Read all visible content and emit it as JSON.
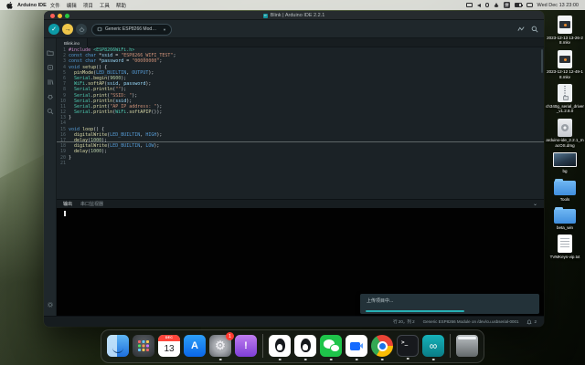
{
  "menu_bar": {
    "app_name": "Arduino IDE",
    "menus": [
      "文件",
      "编辑",
      "项目",
      "工具",
      "帮助"
    ],
    "input_method": "拼",
    "clock": "Wed Dec 13 23:00",
    "status_icon_names": [
      "screen-mirroring-icon",
      "volume-icon",
      "bluetooth-icon",
      "control-center-icon",
      "wifi-icon",
      "input-method-icon",
      "battery-icon",
      "siri-icon"
    ]
  },
  "window": {
    "title": "Blink | Arduino IDE 2.2.1",
    "toolbar": {
      "verify_glyph": "✓",
      "upload_glyph": "→",
      "board_selector": "Generic ESP8266 Mod…",
      "dropdown_caret": "▼",
      "right_icon_names": [
        "serial-plotter-icon",
        "serial-monitor-icon"
      ]
    },
    "activity_bar_icon_names": [
      "sketchbook-folder-icon",
      "boards-manager-icon",
      "library-manager-icon",
      "debug-icon",
      "search-icon",
      "settings-gear-icon"
    ],
    "tab": "Blink.ino",
    "panel": {
      "tabs": [
        "输出",
        "串口监视器"
      ],
      "active_tab": "输出",
      "collapse_glyph": "⌄",
      "console_text": ""
    },
    "toast": {
      "text": "上传项目中...",
      "progress_pct": 55
    },
    "status_bar": {
      "cursor_position": "行 20，列 2",
      "board_info": "Generic ESP8266 Module on /dev/cu.usbserial-0001",
      "notification_count": "2"
    }
  },
  "editor": {
    "syntax_colors": {
      "d": "#c586c0",
      "t": "#4ec9b0",
      "k": "#569cd6",
      "f": "#dcdcaa",
      "s": "#ce9178",
      "n": "#b5cea8",
      "v": "#9cdcfe",
      "p": "#cfd4d8"
    },
    "lines": [
      {
        "n": 1,
        "seg": [
          [
            "d",
            "#include"
          ],
          [
            "p",
            " "
          ],
          [
            "t",
            "<ESP8266WiFi.h>"
          ]
        ]
      },
      {
        "n": 2,
        "seg": [
          [
            "k",
            "const"
          ],
          [
            "p",
            " "
          ],
          [
            "k",
            "char"
          ],
          [
            "p",
            " *"
          ],
          [
            "v",
            "ssid"
          ],
          [
            "p",
            " = "
          ],
          [
            "s",
            "\"ESP8266_WIFI_TEST\""
          ],
          [
            "p",
            ";"
          ]
        ]
      },
      {
        "n": 3,
        "seg": [
          [
            "k",
            "const"
          ],
          [
            "p",
            " "
          ],
          [
            "k",
            "char"
          ],
          [
            "p",
            " *"
          ],
          [
            "v",
            "password"
          ],
          [
            "p",
            " = "
          ],
          [
            "s",
            "\"00000000\""
          ],
          [
            "p",
            ";"
          ]
        ]
      },
      {
        "n": 4,
        "seg": [
          [
            "k",
            "void"
          ],
          [
            "p",
            " "
          ],
          [
            "f",
            "setup"
          ],
          [
            "p",
            "() {"
          ]
        ]
      },
      {
        "n": 5,
        "seg": [
          [
            "p",
            "  "
          ],
          [
            "f",
            "pinMode"
          ],
          [
            "p",
            "("
          ],
          [
            "k",
            "LED_BUILTIN"
          ],
          [
            "p",
            ", "
          ],
          [
            "k",
            "OUTPUT"
          ],
          [
            "p",
            ");"
          ]
        ]
      },
      {
        "n": 6,
        "seg": [
          [
            "p",
            "  "
          ],
          [
            "t",
            "Serial"
          ],
          [
            "p",
            "."
          ],
          [
            "f",
            "begin"
          ],
          [
            "p",
            "("
          ],
          [
            "n",
            "9600"
          ],
          [
            "p",
            ");"
          ]
        ]
      },
      {
        "n": 7,
        "seg": [
          [
            "p",
            "  "
          ],
          [
            "t",
            "WiFi"
          ],
          [
            "p",
            "."
          ],
          [
            "f",
            "softAP"
          ],
          [
            "p",
            "("
          ],
          [
            "v",
            "ssid"
          ],
          [
            "p",
            ", "
          ],
          [
            "v",
            "password"
          ],
          [
            "p",
            ");"
          ]
        ]
      },
      {
        "n": 8,
        "seg": [
          [
            "p",
            "  "
          ],
          [
            "t",
            "Serial"
          ],
          [
            "p",
            "."
          ],
          [
            "f",
            "println"
          ],
          [
            "p",
            "("
          ],
          [
            "s",
            "\"\""
          ],
          [
            "p",
            ");"
          ]
        ]
      },
      {
        "n": 9,
        "seg": [
          [
            "p",
            "  "
          ],
          [
            "t",
            "Serial"
          ],
          [
            "p",
            "."
          ],
          [
            "f",
            "print"
          ],
          [
            "p",
            "("
          ],
          [
            "s",
            "\"SSID: \""
          ],
          [
            "p",
            ");"
          ]
        ]
      },
      {
        "n": 10,
        "seg": [
          [
            "p",
            "  "
          ],
          [
            "t",
            "Serial"
          ],
          [
            "p",
            "."
          ],
          [
            "f",
            "println"
          ],
          [
            "p",
            "("
          ],
          [
            "v",
            "ssid"
          ],
          [
            "p",
            ");"
          ]
        ]
      },
      {
        "n": 11,
        "seg": [
          [
            "p",
            "  "
          ],
          [
            "t",
            "Serial"
          ],
          [
            "p",
            "."
          ],
          [
            "f",
            "print"
          ],
          [
            "p",
            "("
          ],
          [
            "s",
            "\"AP IP address: \""
          ],
          [
            "p",
            ");"
          ]
        ]
      },
      {
        "n": 12,
        "seg": [
          [
            "p",
            "  "
          ],
          [
            "t",
            "Serial"
          ],
          [
            "p",
            "."
          ],
          [
            "f",
            "println"
          ],
          [
            "p",
            "("
          ],
          [
            "t",
            "WiFi"
          ],
          [
            "p",
            "."
          ],
          [
            "f",
            "softAPIP"
          ],
          [
            "p",
            "());"
          ]
        ]
      },
      {
        "n": 13,
        "seg": [
          [
            "p",
            "}"
          ]
        ]
      },
      {
        "n": 14,
        "seg": []
      },
      {
        "n": 15,
        "seg": [
          [
            "k",
            "void"
          ],
          [
            "p",
            " "
          ],
          [
            "f",
            "loop"
          ],
          [
            "p",
            "() {"
          ]
        ]
      },
      {
        "n": 16,
        "seg": [
          [
            "p",
            "  "
          ],
          [
            "f",
            "digitalWrite"
          ],
          [
            "p",
            "("
          ],
          [
            "k",
            "LED_BUILTIN"
          ],
          [
            "p",
            ", "
          ],
          [
            "k",
            "HIGH"
          ],
          [
            "p",
            ");"
          ]
        ]
      },
      {
        "n": 17,
        "seg": [
          [
            "p",
            "  "
          ],
          [
            "f",
            "delay"
          ],
          [
            "p",
            "("
          ],
          [
            "n",
            "1000"
          ],
          [
            "p",
            ");"
          ]
        ]
      },
      {
        "n": 18,
        "seg": [
          [
            "p",
            "  "
          ],
          [
            "f",
            "digitalWrite"
          ],
          [
            "p",
            "("
          ],
          [
            "k",
            "LED_BUILTIN"
          ],
          [
            "p",
            ", "
          ],
          [
            "k",
            "LOW"
          ],
          [
            "p",
            ");"
          ]
        ]
      },
      {
        "n": 19,
        "seg": [
          [
            "p",
            "  "
          ],
          [
            "f",
            "delay"
          ],
          [
            "p",
            "("
          ],
          [
            "n",
            "1000"
          ],
          [
            "p",
            ");"
          ]
        ]
      },
      {
        "n": 20,
        "seg": [
          [
            "p",
            "}"
          ]
        ]
      },
      {
        "n": 21,
        "seg": []
      }
    ]
  },
  "desktop_icons": [
    {
      "kind": "video",
      "label": "2023-12-13 13-26-28.mkv"
    },
    {
      "kind": "video",
      "label": "2023-12-12 12-49-18.mkv"
    },
    {
      "kind": "archive",
      "label": "ch340g_serial_driver_v1.2.8.0"
    },
    {
      "kind": "dmg",
      "label": "arduino-ide_2.2.1_macOS.dmg"
    },
    {
      "kind": "image",
      "label": "bg"
    },
    {
      "kind": "folder",
      "label": "Tools"
    },
    {
      "kind": "folder",
      "label": "beta_win"
    },
    {
      "kind": "text",
      "label": "TVMKeys-vip.txt"
    }
  ],
  "dock": {
    "items": [
      {
        "name": "finder",
        "running": true
      },
      {
        "name": "launchpad"
      },
      {
        "name": "calendar",
        "month": "DEC",
        "day": "13"
      },
      {
        "name": "app-store",
        "glyph": "A"
      },
      {
        "name": "system-settings",
        "glyph": "⚙",
        "badge": "1",
        "running": true
      },
      {
        "name": "feedback-assistant",
        "glyph": "!"
      },
      {
        "name": "separator"
      },
      {
        "name": "qq",
        "running": true
      },
      {
        "name": "qq",
        "running": true
      },
      {
        "name": "wechat",
        "running": true
      },
      {
        "name": "tencent-meeting",
        "running": true
      },
      {
        "name": "chrome",
        "running": true
      },
      {
        "name": "terminal",
        "glyph": ">_",
        "running": true
      },
      {
        "name": "arduino-ide",
        "glyph": "∞",
        "running": true
      },
      {
        "name": "separator"
      },
      {
        "name": "trash"
      }
    ]
  },
  "colors": {
    "accent_teal": "#0c9aa6",
    "upload_yellow": "#efc64a",
    "traffic_red": "#ff5f57",
    "traffic_yellow": "#febc2e",
    "traffic_green": "#28c840",
    "toast_progress": "#27b0b5"
  }
}
